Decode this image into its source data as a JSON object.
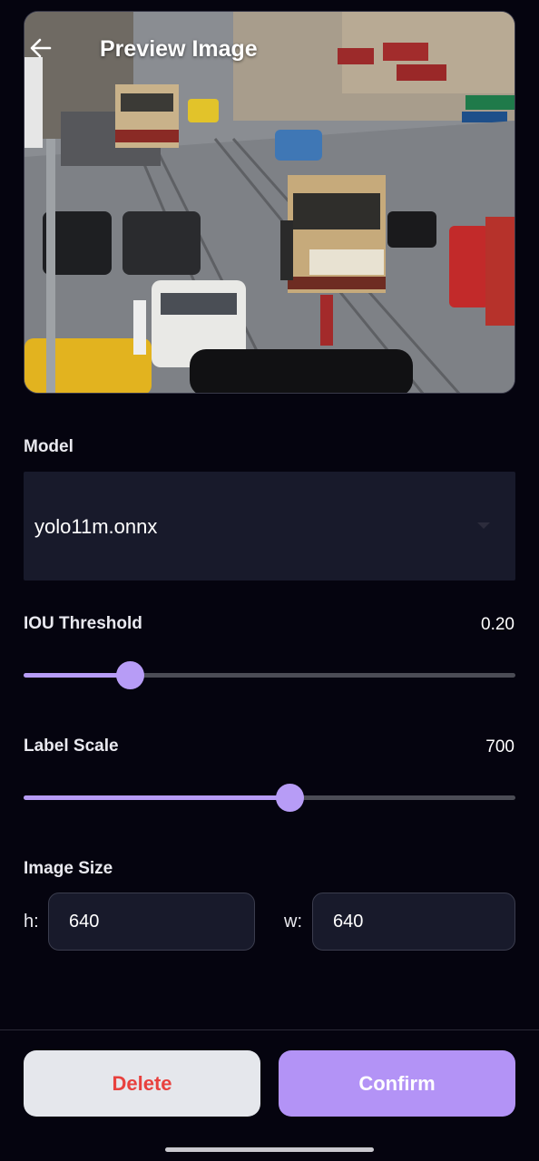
{
  "header": {
    "title": "Preview Image",
    "back_icon": "arrow-left-icon"
  },
  "image": {
    "description_icon": "street-scene-photo"
  },
  "model": {
    "label": "Model",
    "selected": "yolo11m.onnx",
    "dropdown_icon": "caret-down-icon"
  },
  "iou": {
    "label": "IOU Threshold",
    "value_text": "0.20",
    "fraction": 0.216
  },
  "label_scale": {
    "label": "Label Scale",
    "value_text": "700",
    "fraction": 0.541
  },
  "image_size": {
    "label": "Image Size",
    "h_prefix": "h:",
    "h_value": "640",
    "w_prefix": "w:",
    "w_value": "640"
  },
  "actions": {
    "delete_label": "Delete",
    "confirm_label": "Confirm"
  },
  "colors": {
    "background": "#05040f",
    "accent": "#b79cf6",
    "delete_text": "#e8413e",
    "field_bg": "#181a2b"
  }
}
